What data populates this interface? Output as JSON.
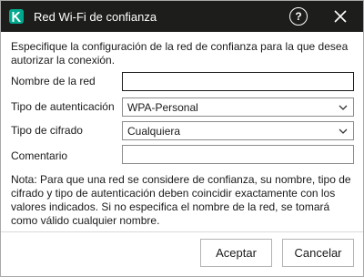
{
  "window": {
    "title": "Red Wi-Fi de confianza",
    "logo_letter": "k",
    "titlebar_color": "#1d1d1b",
    "logo_color": "#00a88e"
  },
  "titlebar": {
    "help_icon": "help-circle-icon",
    "help_glyph": "?",
    "close_icon": "close-icon"
  },
  "intro_text": "Especifique la configuración de la red de confianza para la que desea autorizar la conexión.",
  "form": {
    "network_name": {
      "label": "Nombre de la red",
      "value": "",
      "placeholder": ""
    },
    "auth_type": {
      "label": "Tipo de autenticación",
      "value": "WPA-Personal"
    },
    "encryption_type": {
      "label": "Tipo de cifrado",
      "value": "Cualquiera"
    },
    "comment": {
      "label": "Comentario",
      "value": "",
      "placeholder": ""
    }
  },
  "note_text": "Nota: Para que una red se considere de confianza, su nombre, tipo de cifrado y tipo de autenticación deben coincidir exactamente con los valores indicados. Si no especifica el nombre de la red, se tomará como válido cualquier nombre.",
  "buttons": {
    "accept_label": "Aceptar",
    "cancel_label": "Cancelar"
  }
}
